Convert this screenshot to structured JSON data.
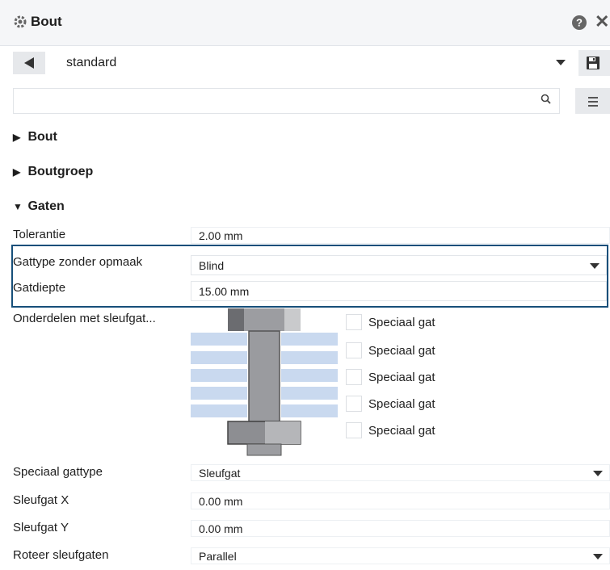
{
  "panel": {
    "title": "Bout"
  },
  "settings": {
    "selected": "standard"
  },
  "search": {
    "value": "",
    "placeholder": ""
  },
  "sections": [
    {
      "label": "Bout",
      "expanded": false
    },
    {
      "label": "Boutgroep",
      "expanded": false
    },
    {
      "label": "Gaten",
      "expanded": true
    }
  ],
  "properties": {
    "tolerantie": {
      "label": "Tolerantie",
      "value": "2.00 mm"
    },
    "gattype": {
      "label": "Gattype zonder opmaak",
      "value": "Blind"
    },
    "gatdiepte": {
      "label": "Gatdiepte",
      "value": "15.00 mm"
    },
    "onderdelen": {
      "label": "Onderdelen met sleufgat..."
    },
    "speciaal_gattype": {
      "label": "Speciaal gattype",
      "value": "Sleufgat"
    },
    "sleufgat_x": {
      "label": "Sleufgat X",
      "value": "0.00 mm"
    },
    "sleufgat_y": {
      "label": "Sleufgat Y",
      "value": "0.00 mm"
    },
    "roteer": {
      "label": "Roteer sleufgaten",
      "value": "Parallel"
    }
  },
  "special_holes": [
    {
      "label": "Speciaal gat",
      "checked": false
    },
    {
      "label": "Speciaal gat",
      "checked": false
    },
    {
      "label": "Speciaal gat",
      "checked": false
    },
    {
      "label": "Speciaal gat",
      "checked": false
    },
    {
      "label": "Speciaal gat",
      "checked": false
    }
  ],
  "colors": {
    "highlight_border": "#174f7a",
    "plate_blue": "#c9d9ef",
    "bolt_gray": "#9a9b9f"
  }
}
